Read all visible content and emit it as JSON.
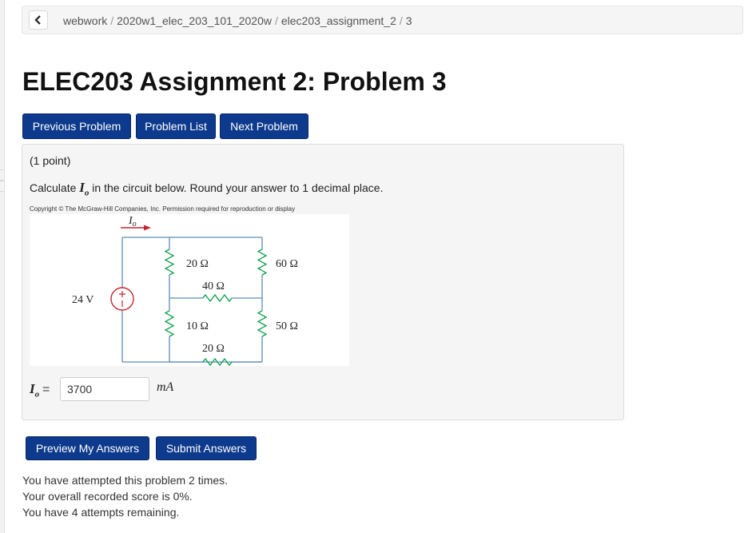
{
  "breadcrumb": {
    "items": [
      "webwork",
      "2020w1_elec_203_101_2020w",
      "elec203_assignment_2",
      "3"
    ],
    "separator": "/"
  },
  "page": {
    "title": "ELEC203 Assignment 2: Problem 3"
  },
  "nav": {
    "previous_label": "Previous Problem",
    "list_label": "Problem List",
    "next_label": "Next Problem"
  },
  "problem": {
    "points": "(1 point)",
    "statement_before": "Calculate",
    "var_symbol": "I",
    "var_sub": "o",
    "statement_after": "in the circuit below. Round your answer to 1 decimal place.",
    "copyright": "Copyright © The McGraw-Hill Companies, Inc. Permission required for reproduction or display",
    "circuit_labels": {
      "current": "I",
      "current_sub": "o",
      "source": "24 V",
      "r1": "20 Ω",
      "r2": "40 Ω",
      "r3": "60 Ω",
      "r4": "10 Ω",
      "r5": "50 Ω",
      "r6": "20 Ω"
    },
    "answer": {
      "lhs_symbol": "I",
      "lhs_sub": "o",
      "equals": "=",
      "value": "3700",
      "unit": "mA"
    }
  },
  "actions": {
    "preview_label": "Preview My Answers",
    "submit_label": "Submit Answers"
  },
  "status": {
    "attempts": "You have attempted this problem 2 times.",
    "score": "Your overall recorded score is 0%.",
    "remaining": "You have 4 attempts remaining."
  },
  "colors": {
    "button": "#0d3a8c",
    "resistor": "#0aa14a",
    "wire": "#5b8db5",
    "arrow": "#c8262c"
  }
}
